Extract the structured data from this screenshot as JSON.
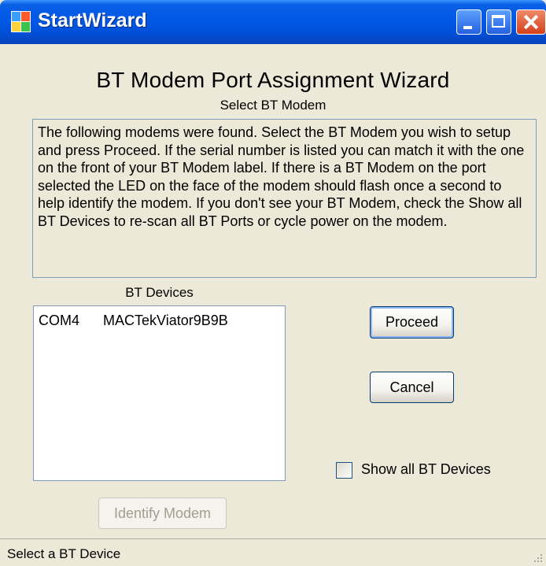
{
  "window": {
    "title": "StartWizard"
  },
  "wizard": {
    "title": "BT Modem Port Assignment Wizard",
    "subtitle": "Select BT Modem",
    "description": "The following modems were found.  Select the BT Modem you wish to setup and press Proceed.  If the serial number is listed you can match it with the one on the front of your BT Modem label.  If there is a BT Modem on the port selected the LED on the face of the modem should flash once a second to help identify the modem.  If you don't see your BT Modem, check the Show all BT Devices to re-scan all BT Ports or cycle power on the modem."
  },
  "devices": {
    "label": "BT Devices",
    "items": [
      {
        "port": "COM4",
        "name": "MACTekViator9B9B"
      }
    ]
  },
  "buttons": {
    "proceed": "Proceed",
    "cancel": "Cancel",
    "identify": "Identify Modem"
  },
  "checkbox": {
    "label": "Show all BT Devices",
    "checked": false
  },
  "status": {
    "text": "Select a BT Device"
  },
  "colors": {
    "titlebar": "#0058e6",
    "window_bg": "#ece9d8",
    "border": "#7f9db9"
  }
}
